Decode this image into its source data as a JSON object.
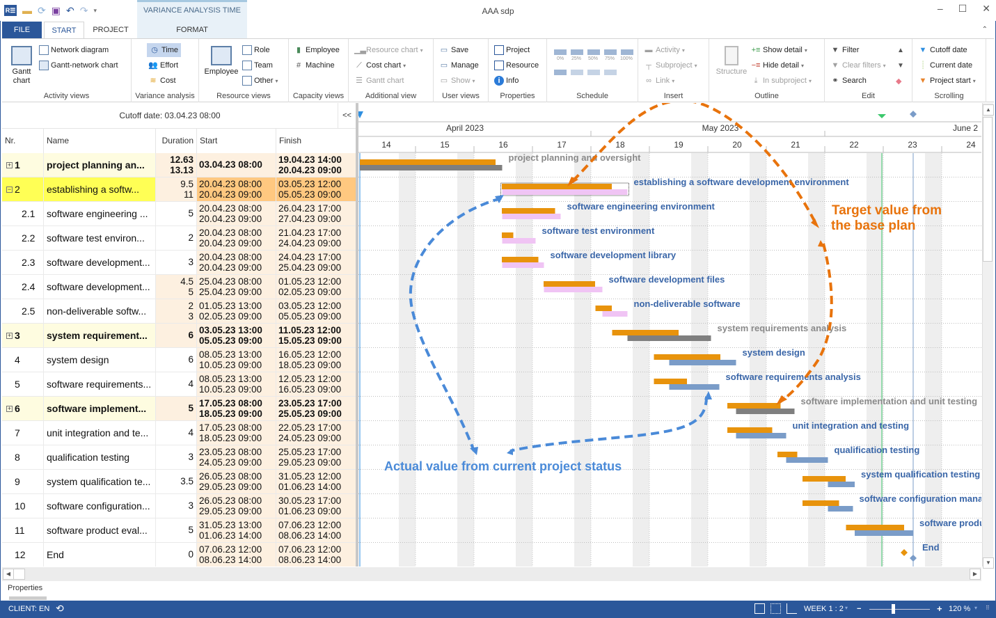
{
  "app": {
    "title": "AAA sdp",
    "context_tab_title": "VARIANCE ANALYSIS TIME",
    "qat_icons": [
      "app-logo-icon",
      "open-folder-icon",
      "refresh-icon",
      "save-icon",
      "undo-icon",
      "redo-icon",
      "customize-qat-icon"
    ]
  },
  "tabs": [
    {
      "label": "FILE"
    },
    {
      "label": "START"
    },
    {
      "label": "PROJECT"
    },
    {
      "label": "FORMAT"
    }
  ],
  "ribbon": {
    "activity_views": {
      "label": "Activity views",
      "gantt": "Gantt chart",
      "network": "Network diagram",
      "gantt_network": "Gantt-network chart"
    },
    "variance": {
      "label": "Variance analysis",
      "time": "Time",
      "effort": "Effort",
      "cost": "Cost"
    },
    "resource_views": {
      "label": "Resource views",
      "employee": "Employee",
      "role": "Role",
      "team": "Team",
      "other": "Other"
    },
    "capacity_views": {
      "label": "Capacity views",
      "employee": "Employee",
      "machine": "Machine"
    },
    "additional_view": {
      "label": "Additional view",
      "resource_chart": "Resource chart",
      "cost_chart": "Cost chart",
      "gantt_chart": "Gantt chart"
    },
    "user_views": {
      "label": "User views",
      "save": "Save",
      "manage": "Manage",
      "show": "Show"
    },
    "properties": {
      "label": "Properties",
      "project": "Project",
      "resource": "Resource",
      "info": "Info"
    },
    "schedule": {
      "label": "Schedule",
      "percents": [
        "0%",
        "25%",
        "50%",
        "75%",
        "100%"
      ]
    },
    "insert": {
      "label": "Insert",
      "activity": "Activity",
      "subproject": "Subproject",
      "link": "Link"
    },
    "outline": {
      "label": "Outline",
      "structure": "Structure",
      "show_detail": "Show detail",
      "hide_detail": "Hide detail",
      "in_subproject": "In subproject"
    },
    "edit": {
      "label": "Edit",
      "filter": "Filter",
      "clear_filters": "Clear filters",
      "search": "Search"
    },
    "scrolling": {
      "label": "Scrolling",
      "cutoff_date": "Cutoff date",
      "current_date": "Current date",
      "project_start": "Project start"
    }
  },
  "table": {
    "cutoff_label": "Cutoff date: 03.04.23 08:00",
    "collapse_label": "<<",
    "columns": [
      "Nr.",
      "Name",
      "Duration",
      "Start",
      "Finish"
    ],
    "rows": [
      {
        "nr": "1",
        "name": "project planning an...",
        "dur": [
          "12.63",
          "13.13"
        ],
        "start": [
          "03.04.23 08:00"
        ],
        "finish": [
          "19.04.23 14:00",
          "20.04.23 09:00"
        ],
        "type": "sum",
        "expander": "+"
      },
      {
        "nr": "2",
        "name": "establishing a softw...",
        "dur": [
          "9.5",
          "11"
        ],
        "start": [
          "20.04.23 08:00",
          "20.04.23 09:00"
        ],
        "finish": [
          "03.05.23 12:00",
          "05.05.23 09:00"
        ],
        "type": "sel",
        "expander": "−"
      },
      {
        "nr": "2.1",
        "name": "software engineering ...",
        "dur": [
          "5"
        ],
        "start": [
          "20.04.23 08:00",
          "20.04.23 09:00"
        ],
        "finish": [
          "26.04.23 17:00",
          "27.04.23 09:00"
        ],
        "type": "sub"
      },
      {
        "nr": "2.2",
        "name": "software test environ...",
        "dur": [
          "2"
        ],
        "start": [
          "20.04.23 08:00",
          "20.04.23 09:00"
        ],
        "finish": [
          "21.04.23 17:00",
          "24.04.23 09:00"
        ],
        "type": "sub"
      },
      {
        "nr": "2.3",
        "name": "software development...",
        "dur": [
          "3"
        ],
        "start": [
          "20.04.23 08:00",
          "20.04.23 09:00"
        ],
        "finish": [
          "24.04.23 17:00",
          "25.04.23 09:00"
        ],
        "type": "sub"
      },
      {
        "nr": "2.4",
        "name": "software development...",
        "dur": [
          "4.5",
          "5"
        ],
        "start": [
          "25.04.23 08:00",
          "25.04.23 09:00"
        ],
        "finish": [
          "01.05.23 12:00",
          "02.05.23 09:00"
        ],
        "type": "sub"
      },
      {
        "nr": "2.5",
        "name": "non-deliverable softw...",
        "dur": [
          "2",
          "3"
        ],
        "start": [
          "01.05.23 13:00",
          "02.05.23 09:00"
        ],
        "finish": [
          "03.05.23 12:00",
          "05.05.23 09:00"
        ],
        "type": "sub"
      },
      {
        "nr": "3",
        "name": "system requirement...",
        "dur": [
          "6"
        ],
        "start": [
          "03.05.23 13:00",
          "05.05.23 09:00"
        ],
        "finish": [
          "11.05.23 12:00",
          "15.05.23 09:00"
        ],
        "type": "sum",
        "expander": "+"
      },
      {
        "nr": "4",
        "name": "system design",
        "dur": [
          "6"
        ],
        "start": [
          "08.05.23 13:00",
          "10.05.23 09:00"
        ],
        "finish": [
          "16.05.23 12:00",
          "18.05.23 09:00"
        ],
        "type": "norm"
      },
      {
        "nr": "5",
        "name": "software requirements...",
        "dur": [
          "4"
        ],
        "start": [
          "08.05.23 13:00",
          "10.05.23 09:00"
        ],
        "finish": [
          "12.05.23 12:00",
          "16.05.23 09:00"
        ],
        "type": "norm"
      },
      {
        "nr": "6",
        "name": "software implement...",
        "dur": [
          "5"
        ],
        "start": [
          "17.05.23 08:00",
          "18.05.23 09:00"
        ],
        "finish": [
          "23.05.23 17:00",
          "25.05.23 09:00"
        ],
        "type": "sum",
        "expander": "+"
      },
      {
        "nr": "7",
        "name": "unit integration and te...",
        "dur": [
          "4"
        ],
        "start": [
          "17.05.23 08:00",
          "18.05.23 09:00"
        ],
        "finish": [
          "22.05.23 17:00",
          "24.05.23 09:00"
        ],
        "type": "norm"
      },
      {
        "nr": "8",
        "name": "qualification testing",
        "dur": [
          "3"
        ],
        "start": [
          "23.05.23 08:00",
          "24.05.23 09:00"
        ],
        "finish": [
          "25.05.23 17:00",
          "29.05.23 09:00"
        ],
        "type": "norm"
      },
      {
        "nr": "9",
        "name": "system qualification te...",
        "dur": [
          "3.5"
        ],
        "start": [
          "26.05.23 08:00",
          "29.05.23 09:00"
        ],
        "finish": [
          "31.05.23 12:00",
          "01.06.23 14:00"
        ],
        "type": "norm"
      },
      {
        "nr": "10",
        "name": "software configuration...",
        "dur": [
          "3"
        ],
        "start": [
          "26.05.23 08:00",
          "29.05.23 09:00"
        ],
        "finish": [
          "30.05.23 17:00",
          "01.06.23 09:00"
        ],
        "type": "norm"
      },
      {
        "nr": "11",
        "name": "software product eval...",
        "dur": [
          "5"
        ],
        "start": [
          "31.05.23 13:00",
          "01.06.23 14:00"
        ],
        "finish": [
          "07.06.23 12:00",
          "08.06.23 14:00"
        ],
        "type": "norm"
      },
      {
        "nr": "12",
        "name": "End",
        "dur": [
          "0"
        ],
        "start": [
          "07.06.23 12:00",
          "08.06.23 14:00"
        ],
        "finish": [
          "07.06.23 12:00",
          "08.06.23 14:00"
        ],
        "type": "norm"
      }
    ]
  },
  "chart_data": {
    "type": "gantt",
    "months": [
      {
        "label": "April 2023"
      },
      {
        "label": "May 2023"
      },
      {
        "label": "June 2"
      }
    ],
    "weeks": [
      "14",
      "15",
      "16",
      "17",
      "18",
      "19",
      "20",
      "21",
      "22",
      "23",
      "24"
    ],
    "timeline_start": "03.04.23",
    "cutoff_date": "03.04.23 08:00",
    "current_date": "02.06.23",
    "project_end_marker": "08.06.23 14:00",
    "colors": {
      "target": "#e8930c",
      "actual_summary": "#7f7f7f",
      "actual_task": "#7a9cc8",
      "actual_sub": "#f0c4f4",
      "label_summary": "#8a8a8a",
      "label_task": "#3a66a8",
      "current_line": "#3cc86c",
      "cutoff": "#2f8fe0"
    },
    "bars": [
      {
        "label": "project planning and oversight",
        "target": [
          "03.04.23 08:00",
          "19.04.23 14:00"
        ],
        "actual": [
          "03.04.23 08:00",
          "20.04.23 09:00"
        ],
        "kind": "summary"
      },
      {
        "label": "establishing a software development environment",
        "target": [
          "20.04.23 08:00",
          "03.05.23 12:00"
        ],
        "actual": [
          "20.04.23 09:00",
          "05.05.23 09:00"
        ],
        "kind": "sub"
      },
      {
        "label": "software engineering environment",
        "target": [
          "20.04.23 08:00",
          "26.04.23 17:00"
        ],
        "actual": [
          "20.04.23 09:00",
          "27.04.23 09:00"
        ],
        "kind": "sub"
      },
      {
        "label": "software test environment",
        "target": [
          "20.04.23 08:00",
          "21.04.23 17:00"
        ],
        "actual": [
          "20.04.23 09:00",
          "24.04.23 09:00"
        ],
        "kind": "sub"
      },
      {
        "label": "software development library",
        "target": [
          "20.04.23 08:00",
          "24.04.23 17:00"
        ],
        "actual": [
          "20.04.23 09:00",
          "25.04.23 09:00"
        ],
        "kind": "sub"
      },
      {
        "label": "software development files",
        "target": [
          "25.04.23 08:00",
          "01.05.23 12:00"
        ],
        "actual": [
          "25.04.23 09:00",
          "02.05.23 09:00"
        ],
        "kind": "sub"
      },
      {
        "label": "non-deliverable software",
        "target": [
          "01.05.23 13:00",
          "03.05.23 12:00"
        ],
        "actual": [
          "02.05.23 09:00",
          "05.05.23 09:00"
        ],
        "kind": "sub"
      },
      {
        "label": "system requirements analysis",
        "target": [
          "03.05.23 13:00",
          "11.05.23 12:00"
        ],
        "actual": [
          "05.05.23 09:00",
          "15.05.23 09:00"
        ],
        "kind": "summary"
      },
      {
        "label": "system design",
        "target": [
          "08.05.23 13:00",
          "16.05.23 12:00"
        ],
        "actual": [
          "10.05.23 09:00",
          "18.05.23 09:00"
        ],
        "kind": "task"
      },
      {
        "label": "software requirements analysis",
        "target": [
          "08.05.23 13:00",
          "12.05.23 12:00"
        ],
        "actual": [
          "10.05.23 09:00",
          "16.05.23 09:00"
        ],
        "kind": "task"
      },
      {
        "label": "software implementation and unit testing",
        "target": [
          "17.05.23 08:00",
          "23.05.23 17:00"
        ],
        "actual": [
          "18.05.23 09:00",
          "25.05.23 09:00"
        ],
        "kind": "summary"
      },
      {
        "label": "unit integration and testing",
        "target": [
          "17.05.23 08:00",
          "22.05.23 17:00"
        ],
        "actual": [
          "18.05.23 09:00",
          "24.05.23 09:00"
        ],
        "kind": "task"
      },
      {
        "label": "qualification testing",
        "target": [
          "23.05.23 08:00",
          "25.05.23 17:00"
        ],
        "actual": [
          "24.05.23 09:00",
          "29.05.23 09:00"
        ],
        "kind": "task"
      },
      {
        "label": "system qualification testing",
        "target": [
          "26.05.23 08:00",
          "31.05.23 12:00"
        ],
        "actual": [
          "29.05.23 09:00",
          "01.06.23 14:00"
        ],
        "kind": "task"
      },
      {
        "label": "software configuration mana",
        "target": [
          "26.05.23 08:00",
          "30.05.23 17:00"
        ],
        "actual": [
          "29.05.23 09:00",
          "01.06.23 09:00"
        ],
        "kind": "task"
      },
      {
        "label": "software produ",
        "target": [
          "31.05.23 13:00",
          "07.06.23 12:00"
        ],
        "actual": [
          "01.06.23 14:00",
          "08.06.23 14:00"
        ],
        "kind": "task"
      },
      {
        "label": "End",
        "target": [
          "07.06.23 12:00",
          "07.06.23 12:00"
        ],
        "actual": [
          "08.06.23 14:00",
          "08.06.23 14:00"
        ],
        "kind": "milestone"
      }
    ],
    "annotations": [
      {
        "text": "Target value from the base plan",
        "lines": [
          "Target value from",
          "the base plan"
        ],
        "color": "#e8730c"
      },
      {
        "text": "Actual value from current project status",
        "color": "#4a8ad8"
      }
    ]
  },
  "properties_tab": "Properties",
  "status": {
    "client": "CLIENT: EN",
    "scale": "WEEK 1 : 2",
    "zoom": "120 %",
    "zoom_minus": "−",
    "zoom_plus": "+"
  }
}
